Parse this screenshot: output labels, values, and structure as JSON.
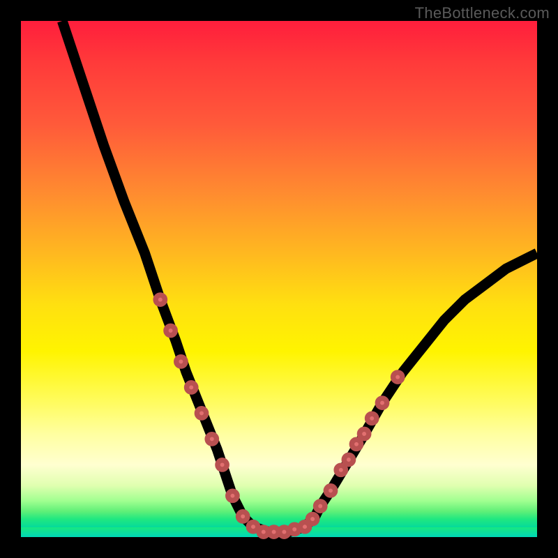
{
  "watermark": "TheBottleneck.com",
  "colors": {
    "gradient_top": "#ff1e3c",
    "gradient_mid": "#ffe010",
    "gradient_bottom": "#00d8d8",
    "curve": "#000000",
    "dots": "#e27070",
    "frame": "#000000"
  },
  "chart_data": {
    "type": "line",
    "title": "",
    "xlabel": "",
    "ylabel": "",
    "xlim": [
      0,
      100
    ],
    "ylim": [
      0,
      100
    ],
    "grid": false,
    "legend": false,
    "series": [
      {
        "name": "curve",
        "x": [
          8,
          12,
          16,
          20,
          24,
          27,
          30,
          32,
          34,
          36,
          38,
          39,
          40,
          41,
          42,
          43,
          45,
          48,
          52,
          55,
          57,
          58,
          60,
          63,
          66,
          70,
          74,
          78,
          82,
          86,
          90,
          94,
          98,
          100
        ],
        "y": [
          100,
          88,
          76,
          65,
          55,
          46,
          38,
          32,
          27,
          22,
          17,
          14,
          11,
          8,
          6,
          4,
          2,
          1,
          1,
          2,
          4,
          6,
          9,
          14,
          19,
          26,
          32,
          37,
          42,
          46,
          49,
          52,
          54,
          55
        ]
      }
    ],
    "annotations": {
      "dots_on_curve": [
        {
          "x": 27,
          "y": 46
        },
        {
          "x": 29,
          "y": 40
        },
        {
          "x": 31,
          "y": 34
        },
        {
          "x": 33,
          "y": 29
        },
        {
          "x": 35,
          "y": 24
        },
        {
          "x": 37,
          "y": 19
        },
        {
          "x": 39,
          "y": 14
        },
        {
          "x": 41,
          "y": 8
        },
        {
          "x": 43,
          "y": 4
        },
        {
          "x": 45,
          "y": 2
        },
        {
          "x": 47,
          "y": 1
        },
        {
          "x": 49,
          "y": 1
        },
        {
          "x": 51,
          "y": 1
        },
        {
          "x": 53,
          "y": 1.5
        },
        {
          "x": 55,
          "y": 2
        },
        {
          "x": 56.5,
          "y": 3.5
        },
        {
          "x": 58,
          "y": 6
        },
        {
          "x": 60,
          "y": 9
        },
        {
          "x": 62,
          "y": 13
        },
        {
          "x": 63.5,
          "y": 15
        },
        {
          "x": 65,
          "y": 18
        },
        {
          "x": 66.5,
          "y": 20
        },
        {
          "x": 68,
          "y": 23
        },
        {
          "x": 70,
          "y": 26
        },
        {
          "x": 73,
          "y": 31
        }
      ]
    }
  }
}
